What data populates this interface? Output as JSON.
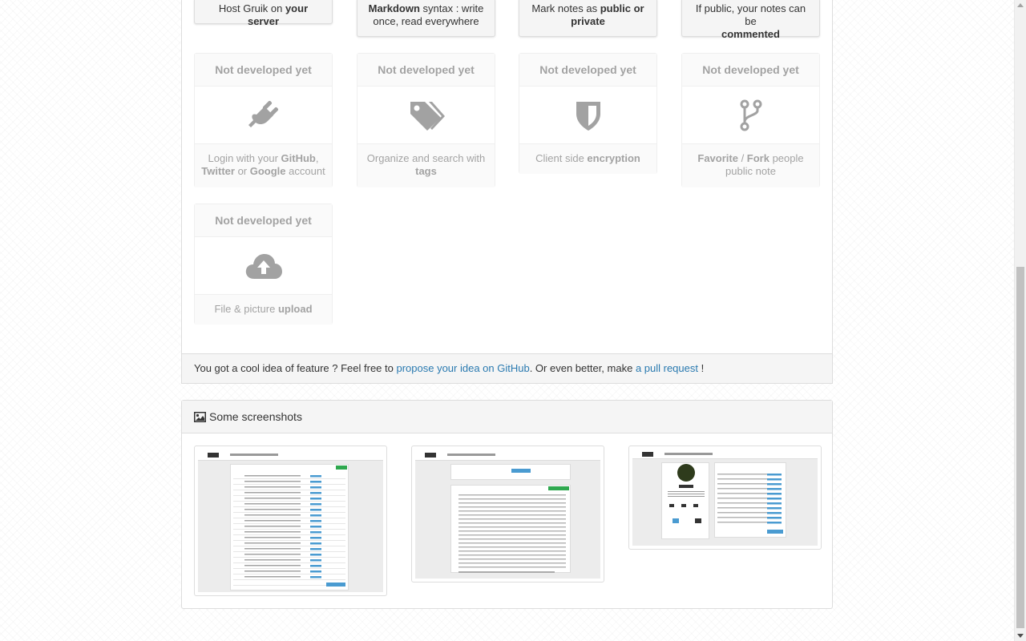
{
  "features_top": [
    {
      "pre": "Host Gruik on ",
      "bold": "your server",
      "post": "",
      "line2_pre": "",
      "line2_bold": "",
      "line2_post": ""
    },
    {
      "pre": "",
      "bold": "Markdown",
      "post": " syntax : write",
      "line2_pre": "once, read everywhere",
      "line2_bold": "",
      "line2_post": ""
    },
    {
      "pre": "Mark notes as ",
      "bold": "public or",
      "post": "",
      "line2_pre": "",
      "line2_bold": "private",
      "line2_post": ""
    },
    {
      "pre": "If public, your notes can be",
      "bold": "",
      "post": "",
      "line2_pre": "",
      "line2_bold": "commented",
      "line2_post": ""
    }
  ],
  "pending_label": "Not developed yet",
  "features_pending": [
    {
      "icon": "plug-icon",
      "l1_parts": [
        "Login with your ",
        "GitHub",
        ","
      ],
      "l2_parts": [
        "Twitter",
        " or ",
        "Google",
        " account"
      ]
    },
    {
      "icon": "tags-icon",
      "l1_parts": [
        "Organize and search with",
        "",
        ""
      ],
      "l2_parts": [
        "",
        "",
        "tags",
        ""
      ]
    },
    {
      "icon": "shield-icon",
      "l1_parts": [
        "Client side ",
        "encryption",
        ""
      ],
      "l2_parts": [
        "",
        "",
        "",
        ""
      ]
    },
    {
      "icon": "code-fork-icon",
      "l1_parts": [
        "",
        "Favorite",
        " / "
      ],
      "l1b": "Fork",
      "l1c": " people",
      "l2_parts": [
        "public note",
        "",
        "",
        ""
      ]
    },
    {
      "icon": "cloud-upload-icon",
      "l1_parts": [
        "File & picture ",
        "upload",
        ""
      ],
      "l2_parts": [
        "",
        "",
        "",
        ""
      ]
    }
  ],
  "contrib": {
    "pre": "You got a cool idea of feature ? Feel free to ",
    "link1": "propose your idea on GitHub",
    "mid": ". Or even better, make ",
    "link2": "a pull request",
    "post": " !"
  },
  "screenshots": {
    "title": "Some screenshots",
    "icon": "picture-icon",
    "items": [
      {
        "alt": "Note list screenshot"
      },
      {
        "alt": "Note editor screenshot"
      },
      {
        "alt": "User profile screenshot"
      }
    ]
  },
  "colors": {
    "link": "#2a7ab0",
    "panel_bg": "#f5f5f5",
    "border": "#dddddd"
  }
}
